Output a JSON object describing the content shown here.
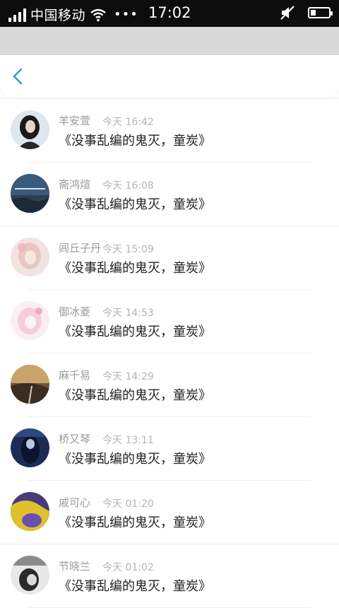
{
  "statusbar": {
    "carrier": "中国移动",
    "dots": "•••",
    "time": "17:02",
    "battery_level": 0.25
  },
  "header": {
    "back_icon": "chevron-left-icon"
  },
  "colors": {
    "accent": "#2d9cdb",
    "statusbar_bg": "#0d0d0d"
  },
  "comments": [
    {
      "name": "羊安萱",
      "time": "今天 16:42",
      "text": "《没事乱编的鬼灭，童炭》"
    },
    {
      "name": "斋鸿煊",
      "time": "今天 16:08",
      "text": "《没事乱编的鬼灭，童炭》"
    },
    {
      "name": "闾丘子丹",
      "time": "今天 15:09",
      "text": "《没事乱编的鬼灭，童炭》"
    },
    {
      "name": "御冰菱",
      "time": "今天 14:53",
      "text": "《没事乱编的鬼灭，童炭》"
    },
    {
      "name": "麻千易",
      "time": "今天 14:29",
      "text": "《没事乱编的鬼灭，童炭》"
    },
    {
      "name": "桥又琴",
      "time": "今天 13:11",
      "text": "《没事乱编的鬼灭，童炭》"
    },
    {
      "name": "戚可心",
      "time": "今天 01:20",
      "text": "《没事乱编的鬼灭，童炭》"
    },
    {
      "name": "节晓兰",
      "time": "今天 01:02",
      "text": "《没事乱编的鬼灭，童炭》"
    }
  ]
}
